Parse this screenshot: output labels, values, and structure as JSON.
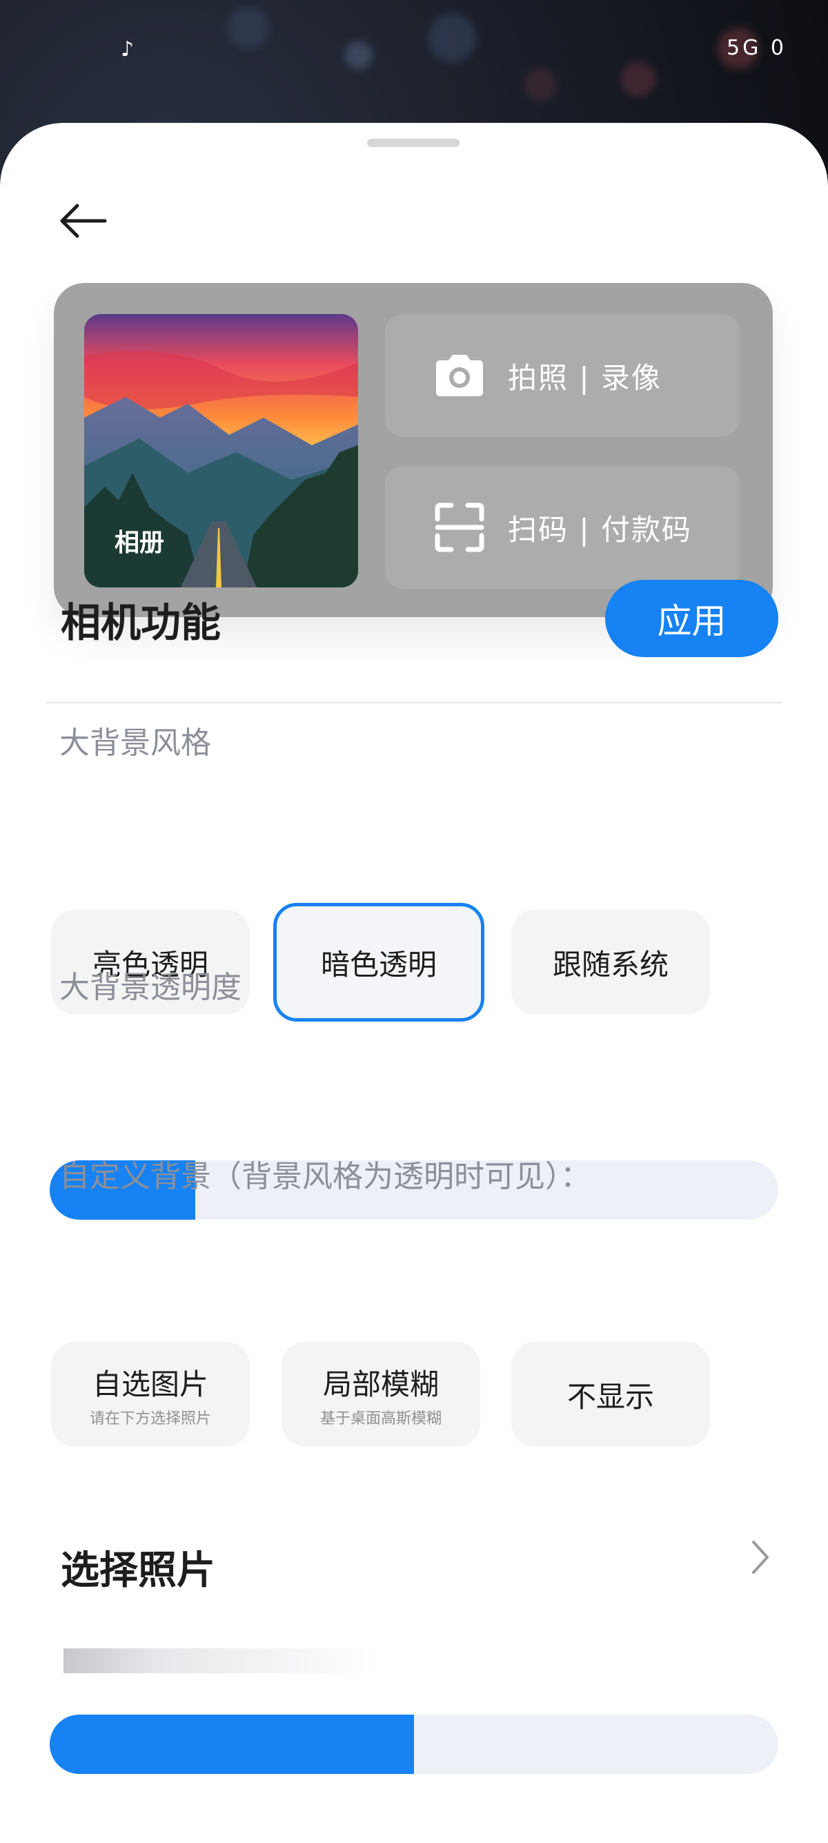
{
  "status_bar": {
    "left_icon": "tiktok-icon",
    "right_text": "5G  0"
  },
  "preview": {
    "album_label": "相册",
    "photo_label": "拍照 | 录像",
    "scan_label": "扫码 | 付款码"
  },
  "header": {
    "title": "相机功能",
    "apply_label": "应用"
  },
  "bg_style": {
    "label": "大背景风格",
    "options": [
      "亮色透明",
      "暗色透明",
      "跟随系统"
    ],
    "selected": "暗色透明"
  },
  "opacity": {
    "label": "大背景透明度",
    "value": 0.2
  },
  "custom_bg": {
    "label": "自定义背景（背景风格为透明时可见）：",
    "options": [
      {
        "title": "自选图片",
        "sub": "请在下方选择照片"
      },
      {
        "title": "局部模糊",
        "sub": "基于桌面高斯模糊"
      },
      {
        "title": "不显示",
        "sub": ""
      }
    ]
  },
  "select_photo": {
    "label": "选择照片"
  },
  "blur_slider": {
    "value": 0.5
  },
  "colors": {
    "accent": "#1682f3",
    "chip_bg": "#f4f4f4",
    "preview_bg": "#a3a3a3"
  }
}
